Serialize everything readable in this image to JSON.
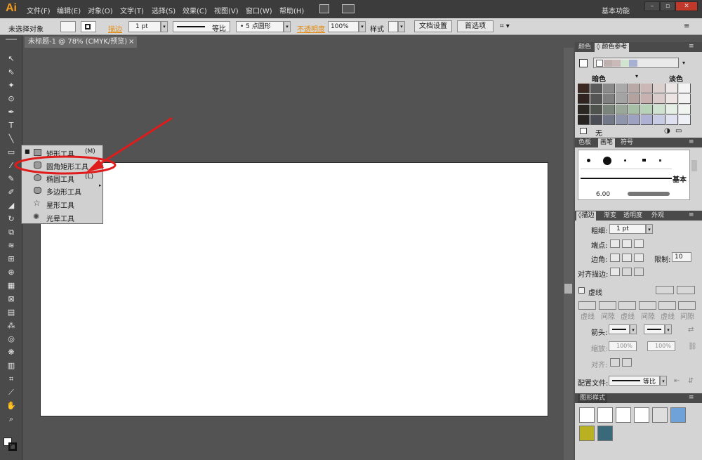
{
  "app": {
    "logo": "Ai"
  },
  "menu": [
    "文件(F)",
    "编辑(E)",
    "对象(O)",
    "文字(T)",
    "选择(S)",
    "效果(C)",
    "视图(V)",
    "窗口(W)",
    "帮助(H)"
  ],
  "workspace": {
    "label": "基本功能"
  },
  "control_bar": {
    "selection_status": "未选择对象",
    "stroke_label": "描边",
    "stroke_weight": "1 pt",
    "profile_label": "等比",
    "brush_label": "5 点圆形",
    "opacity_label": "不透明度",
    "opacity_value": "100%",
    "style_label": "样式",
    "doc_setup_button": "文档设置",
    "prefs_button": "首选项"
  },
  "document_tab": {
    "title": "未标题-1 @ 78% (CMYK/预览)",
    "close": "×"
  },
  "flyout": {
    "items": [
      {
        "label": "矩形工具",
        "key": "(M)"
      },
      {
        "label": "圆角矩形工具",
        "key": ""
      },
      {
        "label": "椭圆工具",
        "key": "(L)"
      },
      {
        "label": "多边形工具",
        "key": ""
      },
      {
        "label": "星形工具",
        "key": ""
      },
      {
        "label": "光晕工具",
        "key": ""
      }
    ]
  },
  "panels": {
    "color": {
      "tabs": [
        "颜色",
        "颜色参考"
      ],
      "left_label": "暗色",
      "right_label": "淡色",
      "none_label": "无"
    },
    "brushes": {
      "tabs": [
        "色板",
        "画笔",
        "符号"
      ],
      "brush_name": "基本",
      "size_value": "6.00"
    },
    "stroke": {
      "tabs": [
        "描边",
        "渐变",
        "透明度",
        "外观"
      ],
      "weight_label": "粗细:",
      "weight_value": "1 pt",
      "cap_label": "端点:",
      "corner_label": "边角:",
      "limit_label": "限制:",
      "limit_value": "10",
      "align_label": "对齐描边:",
      "dashed_label": "虚线",
      "dash_labels": [
        "虚线",
        "间隙",
        "虚线",
        "间隙",
        "虚线",
        "间隙"
      ],
      "arrow_label": "箭头:",
      "scale_label": "缩放:",
      "scale_left": "100%",
      "scale_right": "100%",
      "align_arrow_label": "对齐:",
      "profile_label": "配置文件:",
      "profile_value": "等比"
    },
    "graphic_styles": {
      "tabs": [
        "图形样式"
      ]
    }
  },
  "colors": {
    "swatch_rows": [
      [
        "#3b2a22",
        "#5a5a5a",
        "#8a8a8a",
        "#aaaaaa",
        "#b9a9a6",
        "#cbb7b6",
        "#dcd0cf",
        "#ece6e6",
        "#f4f4f4"
      ],
      [
        "#2f2420",
        "#545454",
        "#808080",
        "#a4a4a4",
        "#b4a29f",
        "#c7b2b0",
        "#d9cccb",
        "#ebe4e3",
        "#f2f2f2"
      ],
      [
        "#2a2622",
        "#4e534e",
        "#7a847a",
        "#9aa89a",
        "#a7bea7",
        "#b7d2b9",
        "#cfe3d0",
        "#e5efe5",
        "#f1f5f1"
      ],
      [
        "#262322",
        "#4a4d55",
        "#727888",
        "#8f96ac",
        "#9da2c2",
        "#aeb1d4",
        "#c8cbe4",
        "#e0e1f0",
        "#eff0f7"
      ]
    ]
  }
}
